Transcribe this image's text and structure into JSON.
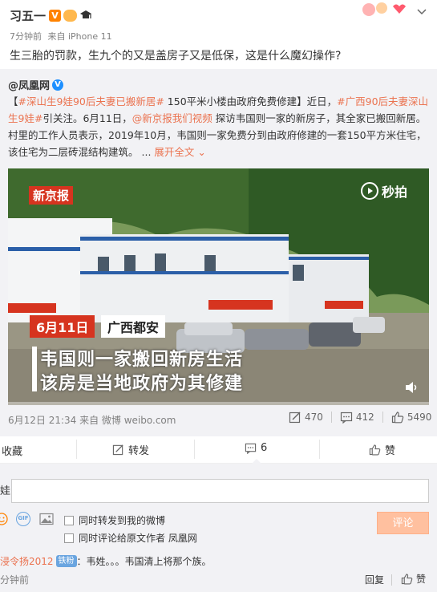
{
  "post": {
    "author": "习五一",
    "time": "7分钟前",
    "source": "来自 iPhone 11",
    "text": "生三胎的罚款，生九个的又是盖房子又是低保，这是什么魔幻操作?"
  },
  "repost": {
    "author": "@凤凰网",
    "hashtag1": "#深山生9娃90后夫妻已搬新居#",
    "text1": " 150平米小楼由政府免费修建】近日，",
    "hashtag2": "#广西90后夫妻深山生9娃#",
    "text2": "引关注。6月11日，",
    "mention": "@新京报我们视频",
    "text3": " 探访韦国则一家的新房子，其全家已搬回新居。村里的工作人员表示，2019年10月，韦国则一家免费分到由政府修建的一套150平方米住宅，该住宅为二层砖混结构建筑。",
    "ellipsis": "...",
    "expand": "展开全文",
    "video": {
      "watermark": "新京报",
      "platform": "秒拍",
      "date_tag": "6月11日",
      "place_tag": "广西都安",
      "subtitle1": "韦国则一家搬回新房生活",
      "subtitle2": "该房是当地政府为其修建"
    },
    "meta": "6月12日 21:34 来自 微博 weibo.com",
    "repost_count": "470",
    "comment_count": "412",
    "like_count": "5490"
  },
  "actions": {
    "favorite": "收藏",
    "forward": "转发",
    "comment": "6",
    "like": "赞"
  },
  "composer": {
    "avatar_text": "娃",
    "option1": "同时转发到我的微博",
    "option2": "同时评论给原文作者 凤凰网",
    "submit": "评论"
  },
  "comment": {
    "user": "浸令扬2012",
    "badge": "铁粉",
    "text": "：韦姓。。。韦国清上将那个族。",
    "time": "分钟前",
    "reply": "回复",
    "like": "赞"
  },
  "colors": {
    "accent": "#eb7350",
    "link": "#eb7350",
    "submit_bg": "#ffc09f",
    "video_tag_red": "#d6341f"
  }
}
